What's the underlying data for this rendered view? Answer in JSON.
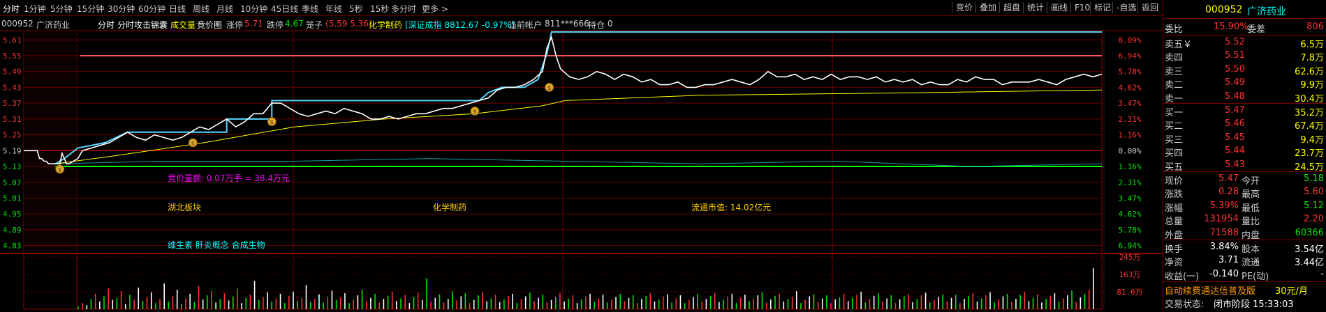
{
  "toolbar": {
    "periods": [
      "分时",
      "1分钟",
      "5分钟",
      "15分钟",
      "30分钟",
      "60分钟",
      "日线",
      "周线",
      "月线",
      "10分钟",
      "45日线",
      "季线",
      "年线",
      "5秒",
      "15秒",
      "多分时",
      "更多 >"
    ],
    "buttons": [
      "竞价",
      "叠加",
      "超盘",
      "统计",
      "画线",
      "F10",
      "标记",
      "-自选",
      "返回"
    ]
  },
  "info": {
    "code": "000952",
    "name": "广济药业",
    "tab_fenshi": "分时",
    "tab_attack": "分时攻击锦囊",
    "vol_label": "成交量",
    "auction_label": "竞价图",
    "limit_up_label": "涨停",
    "limit_up_value": "5.71",
    "limit_down_label": "跌停",
    "limit_down_value": "4.67",
    "cage_label": "笼子",
    "cage_value": "(5.59 5.36)",
    "sector": "化学制药",
    "index_text": "[深证成指 8812.67 -0.97%]",
    "account_label": "当前帐户",
    "account_value": "811***666",
    "position_label": "持仓",
    "position_value": "0"
  },
  "chart": {
    "left_axis": [
      "5.61",
      "5.55",
      "5.49",
      "5.43",
      "5.37",
      "5.31",
      "5.25",
      "5.19",
      "5.13",
      "5.07",
      "5.01",
      "4.95",
      "4.89",
      "4.83"
    ],
    "right_axis": [
      "8.09%",
      "6.94%",
      "5.78%",
      "4.62%",
      "3.47%",
      "2.31%",
      "1.16%",
      "0.00%",
      "1.16%",
      "2.31%",
      "3.47%",
      "4.62%",
      "5.78%",
      "6.94%"
    ],
    "vol_axis": [
      "245万",
      "163万",
      "81.6万"
    ],
    "annotations": {
      "auction": "竞价量额: 0.07万手 = 38.4万元",
      "region": "湖北板块",
      "industry": "化学制药",
      "float_cap": "流通市值: 14.02亿元",
      "concepts": "维生素 肝炎概念 合成生物"
    },
    "colors": {
      "price": "#ffffff",
      "avg": "#ffff00",
      "upper": "#55d8ff",
      "limit": "#ff5a5a",
      "grid": "#8a0000"
    },
    "price_points": [
      [
        0,
        5.19
      ],
      [
        6,
        5.19
      ],
      [
        7,
        5.16
      ],
      [
        8,
        5.16
      ],
      [
        9,
        5.15
      ],
      [
        10,
        5.15
      ],
      [
        11,
        5.14
      ],
      [
        14,
        5.14
      ],
      [
        16,
        5.14
      ],
      [
        17,
        5.18
      ],
      [
        18,
        5.16
      ],
      [
        19,
        5.14
      ],
      [
        20,
        5.14
      ],
      [
        24,
        5.16
      ],
      [
        26,
        5.19
      ],
      [
        30,
        5.2
      ],
      [
        34,
        5.21
      ],
      [
        38,
        5.22
      ],
      [
        42,
        5.24
      ],
      [
        46,
        5.26
      ],
      [
        50,
        5.24
      ],
      [
        54,
        5.23
      ],
      [
        58,
        5.25
      ],
      [
        62,
        5.24
      ],
      [
        66,
        5.23
      ],
      [
        70,
        5.24
      ],
      [
        74,
        5.26
      ],
      [
        78,
        5.28
      ],
      [
        82,
        5.27
      ],
      [
        86,
        5.29
      ],
      [
        90,
        5.31
      ],
      [
        94,
        5.28
      ],
      [
        98,
        5.3
      ],
      [
        102,
        5.33
      ],
      [
        106,
        5.33
      ],
      [
        110,
        5.37
      ],
      [
        114,
        5.37
      ],
      [
        118,
        5.35
      ],
      [
        122,
        5.33
      ],
      [
        126,
        5.32
      ],
      [
        130,
        5.33
      ],
      [
        134,
        5.34
      ],
      [
        138,
        5.33
      ],
      [
        142,
        5.35
      ],
      [
        146,
        5.34
      ],
      [
        150,
        5.33
      ],
      [
        154,
        5.31
      ],
      [
        158,
        5.31
      ],
      [
        162,
        5.32
      ],
      [
        166,
        5.31
      ],
      [
        170,
        5.32
      ],
      [
        174,
        5.33
      ],
      [
        178,
        5.33
      ],
      [
        182,
        5.34
      ],
      [
        186,
        5.35
      ],
      [
        190,
        5.35
      ],
      [
        194,
        5.36
      ],
      [
        198,
        5.37
      ],
      [
        202,
        5.38
      ],
      [
        206,
        5.39
      ],
      [
        210,
        5.42
      ],
      [
        214,
        5.43
      ],
      [
        218,
        5.43
      ],
      [
        222,
        5.44
      ],
      [
        226,
        5.46
      ],
      [
        230,
        5.49
      ],
      [
        232,
        5.58
      ],
      [
        234,
        5.62
      ],
      [
        236,
        5.55
      ],
      [
        238,
        5.5
      ],
      [
        242,
        5.47
      ],
      [
        246,
        5.46
      ],
      [
        250,
        5.47
      ],
      [
        254,
        5.49
      ],
      [
        258,
        5.48
      ],
      [
        262,
        5.46
      ],
      [
        266,
        5.48
      ],
      [
        270,
        5.47
      ],
      [
        274,
        5.45
      ],
      [
        278,
        5.46
      ],
      [
        282,
        5.44
      ],
      [
        286,
        5.44
      ],
      [
        290,
        5.45
      ],
      [
        294,
        5.43
      ],
      [
        298,
        5.43
      ],
      [
        302,
        5.44
      ],
      [
        306,
        5.44
      ],
      [
        310,
        5.45
      ],
      [
        314,
        5.46
      ],
      [
        318,
        5.45
      ],
      [
        322,
        5.44
      ],
      [
        326,
        5.46
      ],
      [
        330,
        5.49
      ],
      [
        334,
        5.47
      ],
      [
        338,
        5.47
      ],
      [
        342,
        5.48
      ],
      [
        346,
        5.46
      ],
      [
        350,
        5.47
      ],
      [
        354,
        5.46
      ],
      [
        358,
        5.48
      ],
      [
        362,
        5.46
      ],
      [
        366,
        5.47
      ],
      [
        370,
        5.47
      ],
      [
        374,
        5.46
      ],
      [
        378,
        5.47
      ],
      [
        382,
        5.45
      ],
      [
        386,
        5.46
      ],
      [
        390,
        5.45
      ],
      [
        394,
        5.46
      ],
      [
        398,
        5.44
      ],
      [
        402,
        5.45
      ],
      [
        406,
        5.44
      ],
      [
        410,
        5.44
      ],
      [
        414,
        5.46
      ],
      [
        418,
        5.45
      ],
      [
        422,
        5.47
      ],
      [
        426,
        5.46
      ],
      [
        430,
        5.46
      ],
      [
        434,
        5.44
      ],
      [
        438,
        5.45
      ],
      [
        442,
        5.45
      ],
      [
        446,
        5.45
      ],
      [
        450,
        5.46
      ],
      [
        454,
        5.45
      ],
      [
        458,
        5.44
      ],
      [
        462,
        5.46
      ],
      [
        466,
        5.47
      ],
      [
        470,
        5.48
      ],
      [
        474,
        5.47
      ],
      [
        478,
        5.48
      ]
    ],
    "avg_points": [
      [
        14,
        5.14
      ],
      [
        40,
        5.17
      ],
      [
        80,
        5.22
      ],
      [
        120,
        5.28
      ],
      [
        160,
        5.31
      ],
      [
        200,
        5.33
      ],
      [
        230,
        5.36
      ],
      [
        240,
        5.38
      ],
      [
        300,
        5.4
      ],
      [
        400,
        5.41
      ],
      [
        478,
        5.42
      ]
    ],
    "upper_points": [
      [
        14,
        5.14
      ],
      [
        18,
        5.16
      ],
      [
        24,
        5.2
      ],
      [
        36,
        5.22
      ],
      [
        46,
        5.26
      ],
      [
        90,
        5.26
      ],
      [
        90,
        5.31
      ],
      [
        110,
        5.31
      ],
      [
        110,
        5.38
      ],
      [
        202,
        5.38
      ],
      [
        206,
        5.41
      ],
      [
        212,
        5.43
      ],
      [
        222,
        5.43
      ],
      [
        228,
        5.46
      ],
      [
        232,
        5.56
      ],
      [
        234,
        5.64
      ],
      [
        478,
        5.64
      ]
    ],
    "limit_price": 5.55,
    "sub_cyan": [
      [
        14,
        5.14
      ],
      [
        60,
        5.15
      ],
      [
        120,
        5.15
      ],
      [
        180,
        5.16
      ],
      [
        240,
        5.15
      ],
      [
        300,
        5.14
      ],
      [
        360,
        5.15
      ],
      [
        420,
        5.13
      ],
      [
        478,
        5.14
      ]
    ],
    "sub_green": [
      [
        14,
        5.13
      ],
      [
        478,
        5.13
      ]
    ],
    "volumes": [
      0.05,
      0.12,
      0.08,
      0.2,
      0.3,
      0.15,
      0.25,
      0.4,
      0.18,
      0.22,
      0.35,
      0.1,
      0.28,
      0.19,
      0.42,
      0.16,
      0.24,
      0.33,
      0.12,
      0.2,
      0.5,
      0.15,
      0.26,
      0.38,
      0.11,
      0.21,
      0.3,
      0.14,
      0.45,
      0.19,
      0.27,
      0.36,
      0.13,
      0.2,
      0.31,
      0.17,
      0.25,
      0.4,
      0.12,
      0.22,
      0.28,
      0.55,
      0.18,
      0.24,
      0.33,
      0.15,
      0.21,
      0.3,
      0.12,
      0.26,
      0.34,
      0.16,
      0.22,
      0.47,
      0.14,
      0.2,
      0.29,
      0.13,
      0.25,
      0.36,
      0.18,
      0.23,
      0.31,
      0.12,
      0.19,
      0.27,
      0.38,
      0.15,
      0.22,
      0.3,
      0.13,
      0.2,
      0.26,
      0.34,
      0.16,
      0.21,
      0.28,
      0.12,
      0.24,
      0.32,
      0.18,
      0.6,
      0.15,
      0.22,
      0.29,
      0.13,
      0.2,
      0.35,
      0.17,
      0.25,
      0.31,
      0.12,
      0.18,
      0.27,
      0.33,
      0.15,
      0.21,
      0.28,
      0.14,
      0.19,
      0.26,
      0.3,
      0.12,
      0.2,
      0.25,
      0.32,
      0.16,
      0.22,
      0.29,
      0.13,
      0.18,
      0.24,
      0.31,
      0.15,
      0.2,
      0.27,
      0.12,
      0.19,
      0.25,
      0.3,
      0.14,
      0.21,
      0.28,
      0.13,
      0.18,
      0.24,
      0.3,
      0.16,
      0.22,
      0.27,
      0.12,
      0.2,
      0.26,
      0.31,
      0.15,
      0.19,
      0.25,
      0.29,
      0.13,
      0.21,
      0.27,
      0.12,
      0.18,
      0.24,
      0.3,
      0.15,
      0.2,
      0.26,
      0.32,
      0.14,
      0.19,
      0.25,
      0.3,
      0.12,
      0.22,
      0.28,
      0.16,
      0.21,
      0.27,
      0.33,
      0.13,
      0.19,
      0.26,
      0.3,
      0.15,
      0.2,
      0.24,
      0.35,
      0.12,
      0.18,
      0.25,
      0.29,
      0.14,
      0.21,
      0.27,
      0.12,
      0.19,
      0.23,
      0.3,
      0.16,
      0.22,
      0.28,
      0.34,
      0.13,
      0.2,
      0.26,
      0.31,
      0.15,
      0.21,
      0.27,
      0.12,
      0.19,
      0.25,
      0.3,
      0.14,
      0.2,
      0.27,
      0.32,
      0.13,
      0.18,
      0.24,
      0.29,
      0.16,
      0.22,
      0.28,
      0.12,
      0.2,
      0.26,
      0.31,
      0.15,
      0.21,
      0.27,
      0.33,
      0.13,
      0.19,
      0.25,
      0.3,
      0.14,
      0.2,
      0.28,
      0.34,
      0.16,
      0.22,
      0.29,
      0.13,
      0.2,
      0.26,
      0.31,
      0.15,
      0.21,
      0.27,
      0.36,
      0.14,
      0.23,
      0.3,
      0.38,
      0.8
    ]
  },
  "quote": {
    "code": "000952",
    "name": "广济药业",
    "weibi_label": "委比",
    "weibi_value": "15.90%",
    "weicha_label": "委差",
    "weicha_value": "806",
    "asks": [
      {
        "label": "卖五￥",
        "price": "5.52",
        "vol": "6.5万"
      },
      {
        "label": "卖四",
        "price": "5.51",
        "vol": "7.8万"
      },
      {
        "label": "卖三",
        "price": "5.50",
        "vol": "62.6万"
      },
      {
        "label": "卖二",
        "price": "5.49",
        "vol": "9.9万"
      },
      {
        "label": "卖一",
        "price": "5.48",
        "vol": "30.4万"
      }
    ],
    "bids": [
      {
        "label": "买一",
        "price": "5.47",
        "vol": "35.2万"
      },
      {
        "label": "买二",
        "price": "5.46",
        "vol": "67.4万"
      },
      {
        "label": "买三",
        "price": "5.45",
        "vol": "9.4万"
      },
      {
        "label": "买四",
        "price": "5.44",
        "vol": "23.7万"
      },
      {
        "label": "买五",
        "price": "5.43",
        "vol": "24.5万"
      }
    ],
    "stats": [
      {
        "l1": "现价",
        "v1": "5.47",
        "l2": "今开",
        "v2": "5.18"
      },
      {
        "l1": "涨跌",
        "v1": "0.28",
        "l2": "最高",
        "v2": "5.60"
      },
      {
        "l1": "涨幅",
        "v1": "5.39%",
        "l2": "最低",
        "v2": "5.12"
      },
      {
        "l1": "总量",
        "v1": "131954",
        "l2": "量比",
        "v2": "2.20"
      },
      {
        "l1": "外盘",
        "v1": "71588",
        "l2": "内盘",
        "v2": "60366"
      }
    ],
    "fin": [
      {
        "l1": "换手",
        "v1": "3.84%",
        "l2": "股本",
        "v2": "3.54亿"
      },
      {
        "l1": "净资",
        "v1": "3.71",
        "l2": "流通",
        "v2": "3.44亿"
      },
      {
        "l1": "收益(一)",
        "v1": "-0.140",
        "l2": "PE(动)",
        "v2": "-"
      }
    ],
    "promo": "自动续费通达信普及版",
    "promo_price": "30元/月",
    "trade_status_label": "交易状态:",
    "trade_status": "闭市阶段 15:33:03"
  }
}
